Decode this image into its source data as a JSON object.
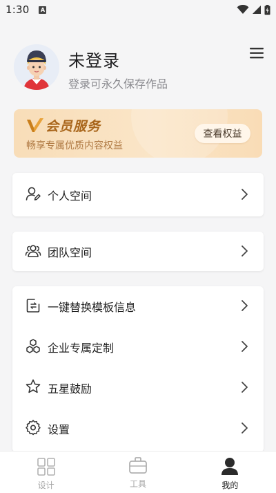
{
  "status_bar": {
    "time": "1:30"
  },
  "profile": {
    "username": "未登录",
    "subtitle": "登录可永久保存作品"
  },
  "vip": {
    "title": "会员服务",
    "description": "畅享专属优质内容权益",
    "button_label": "查看权益"
  },
  "menu": {
    "personal_space": "个人空间",
    "team_space": "团队空间",
    "items": [
      {
        "label": "一键替换模板信息",
        "icon": "replace-icon"
      },
      {
        "label": "企业专属定制",
        "icon": "hexagon-cluster-icon"
      },
      {
        "label": "五星鼓励",
        "icon": "star-icon"
      },
      {
        "label": "设置",
        "icon": "gear-icon"
      }
    ]
  },
  "tabbar": {
    "tabs": [
      {
        "label": "设计",
        "icon": "grid-icon",
        "active": false
      },
      {
        "label": "工具",
        "icon": "toolbox-icon",
        "active": false
      },
      {
        "label": "我的",
        "icon": "user-icon",
        "active": true
      }
    ]
  },
  "colors": {
    "background": "#f5f5f6",
    "vip_gold": "#a8651a",
    "vip_gradient_start": "#f8ddb8",
    "card": "#ffffff",
    "tab_active": "#1f1f1f",
    "tab_inactive": "#a6a6a6"
  }
}
